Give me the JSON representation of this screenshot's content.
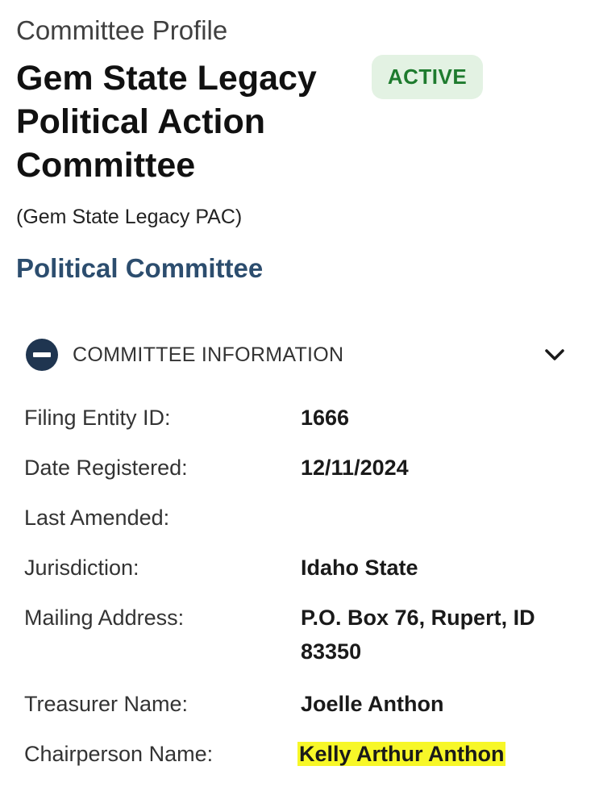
{
  "header": {
    "eyebrow": "Committee Profile",
    "title": "Gem State Legacy Political Action Committee",
    "status_badge": "ACTIVE",
    "abbreviation": "(Gem State Legacy PAC)",
    "committee_type": "Political Committee"
  },
  "section": {
    "title": "COMMITTEE INFORMATION",
    "icon": "minus-circle-icon",
    "toggle_icon": "chevron-down-icon"
  },
  "info": {
    "filing_entity_id": {
      "label": "Filing Entity ID:",
      "value": "1666"
    },
    "date_registered": {
      "label": "Date Registered:",
      "value": "12/11/2024"
    },
    "last_amended": {
      "label": "Last Amended:",
      "value": ""
    },
    "jurisdiction": {
      "label": "Jurisdiction:",
      "value": "Idaho State"
    },
    "mailing_address": {
      "label": "Mailing Address:",
      "value": "P.O. Box 76, Rupert, ID 83350"
    },
    "treasurer_name": {
      "label": "Treasurer Name:",
      "value": "Joelle Anthon"
    },
    "chairperson_name": {
      "label": "Chairperson Name:",
      "value": "Kelly Arthur Anthon"
    }
  },
  "colors": {
    "badge_bg": "#e3f2e3",
    "badge_text": "#1e7b2e",
    "committee_type": "#2c4d6e",
    "section_icon": "#1f3550",
    "highlight": "#f7f728"
  }
}
